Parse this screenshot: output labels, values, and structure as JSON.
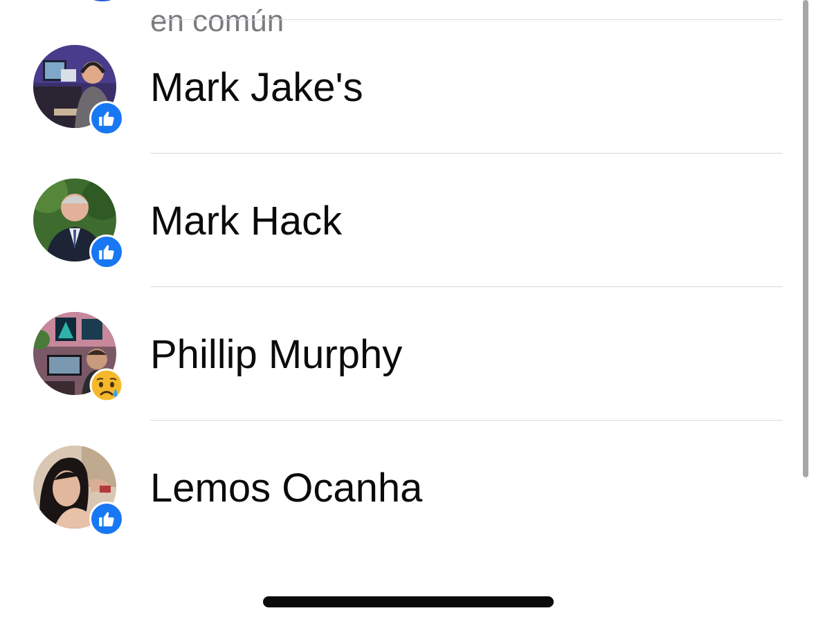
{
  "header": {
    "previous_subtitle": "en común"
  },
  "people": [
    {
      "name": "Mark Jake's",
      "reaction": "like-icon"
    },
    {
      "name": "Mark Hack",
      "reaction": "like-icon"
    },
    {
      "name": "Phillip Murphy",
      "reaction": "sad-face-icon"
    },
    {
      "name": "Lemos Ocanha",
      "reaction": "like-icon"
    }
  ],
  "colors": {
    "like_blue": "#1877f2",
    "divider": "#d8d8dc",
    "subtitle_gray": "#7b7b7f",
    "scrollbar": "#a7a7a9"
  }
}
